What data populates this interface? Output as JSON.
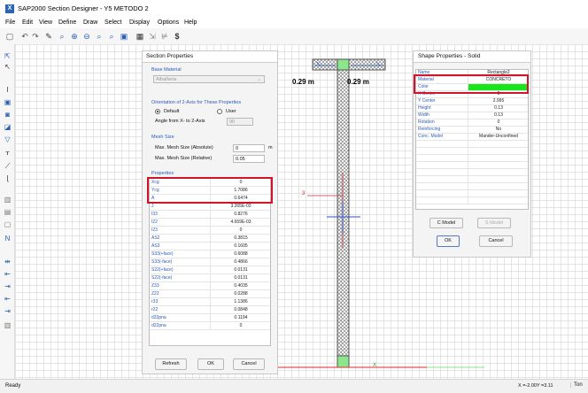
{
  "window": {
    "title": "SAP2000 Section Designer - Y5 METODO 2",
    "app_icon": "sap2000-icon"
  },
  "menu": [
    "File",
    "Edit",
    "View",
    "Define",
    "Draw",
    "Select",
    "Display",
    "Options",
    "Help"
  ],
  "section_properties": {
    "title": "Section Properties",
    "base_material_label": "Base Material",
    "base_material_value": "Albañeria",
    "orientation_label": "Orientation of 2-Axis for These Properties",
    "radio_default": "Default",
    "radio_user": "User",
    "angle_label": "Angle from X- to 2-Axis",
    "angle_value": "90",
    "mesh_label": "Mesh Size",
    "mesh_abs_label": "Max. Mesh Size (Absolute)",
    "mesh_abs_value": "0",
    "mesh_abs_unit": "m",
    "mesh_rel_label": "Max. Mesh Size (Relative)",
    "mesh_rel_value": "0.05",
    "properties_label": "Properties",
    "rows": [
      {
        "name": "Xcg",
        "value": "0"
      },
      {
        "name": "Ycg",
        "value": "1.7086"
      },
      {
        "name": "A",
        "value": "0.6474"
      },
      {
        "name": "J",
        "value": "3.265E-03"
      },
      {
        "name": "I33",
        "value": "0.8276"
      },
      {
        "name": "I22",
        "value": "4.659E-03"
      },
      {
        "name": "I23",
        "value": "0"
      },
      {
        "name": "AS2",
        "value": "0.3815"
      },
      {
        "name": "AS3",
        "value": "0.1605"
      },
      {
        "name": "S33(+face)",
        "value": "0.6088"
      },
      {
        "name": "S33(-face)",
        "value": "0.4866"
      },
      {
        "name": "S22(+face)",
        "value": "0.0131"
      },
      {
        "name": "S22(-face)",
        "value": "0.0131"
      },
      {
        "name": "Z33",
        "value": "0.4035"
      },
      {
        "name": "Z22",
        "value": "0.0288"
      },
      {
        "name": "r33",
        "value": "1.1386"
      },
      {
        "name": "r22",
        "value": "0.0848"
      },
      {
        "name": "d33pna",
        "value": "0.1194"
      },
      {
        "name": "d22pna",
        "value": "0"
      }
    ],
    "buttons": {
      "refresh": "Refresh",
      "ok": "OK",
      "cancel": "Cancel"
    }
  },
  "drawing": {
    "dim_left": "0.29 m",
    "dim_right": "0.29 m",
    "axis_label_3": "3",
    "axis_label_x": "X"
  },
  "shape_properties": {
    "title": "Shape Properties - Solid",
    "rows": [
      {
        "name": "Name",
        "value": "Rectangle2"
      },
      {
        "name": "Material",
        "value": "CONCRETO"
      },
      {
        "name": "Color",
        "value": ""
      },
      {
        "name": "X Center",
        "value": "0"
      },
      {
        "name": "Y Center",
        "value": "2.995"
      },
      {
        "name": "Height",
        "value": "0.13"
      },
      {
        "name": "Width",
        "value": "0.13"
      },
      {
        "name": "Rotation",
        "value": "0"
      },
      {
        "name": "Reinforcing",
        "value": "No"
      },
      {
        "name": "Conc. Model",
        "value": "Mander-Unconfined"
      }
    ],
    "color_swatch": "#19e619",
    "buttons": {
      "c_model": "C Model",
      "s_model": "S Model",
      "ok": "OK",
      "cancel": "Cancel"
    }
  },
  "status": {
    "left": "Ready",
    "coords": "X =-2.00Y =3.11",
    "right": "Ton"
  }
}
